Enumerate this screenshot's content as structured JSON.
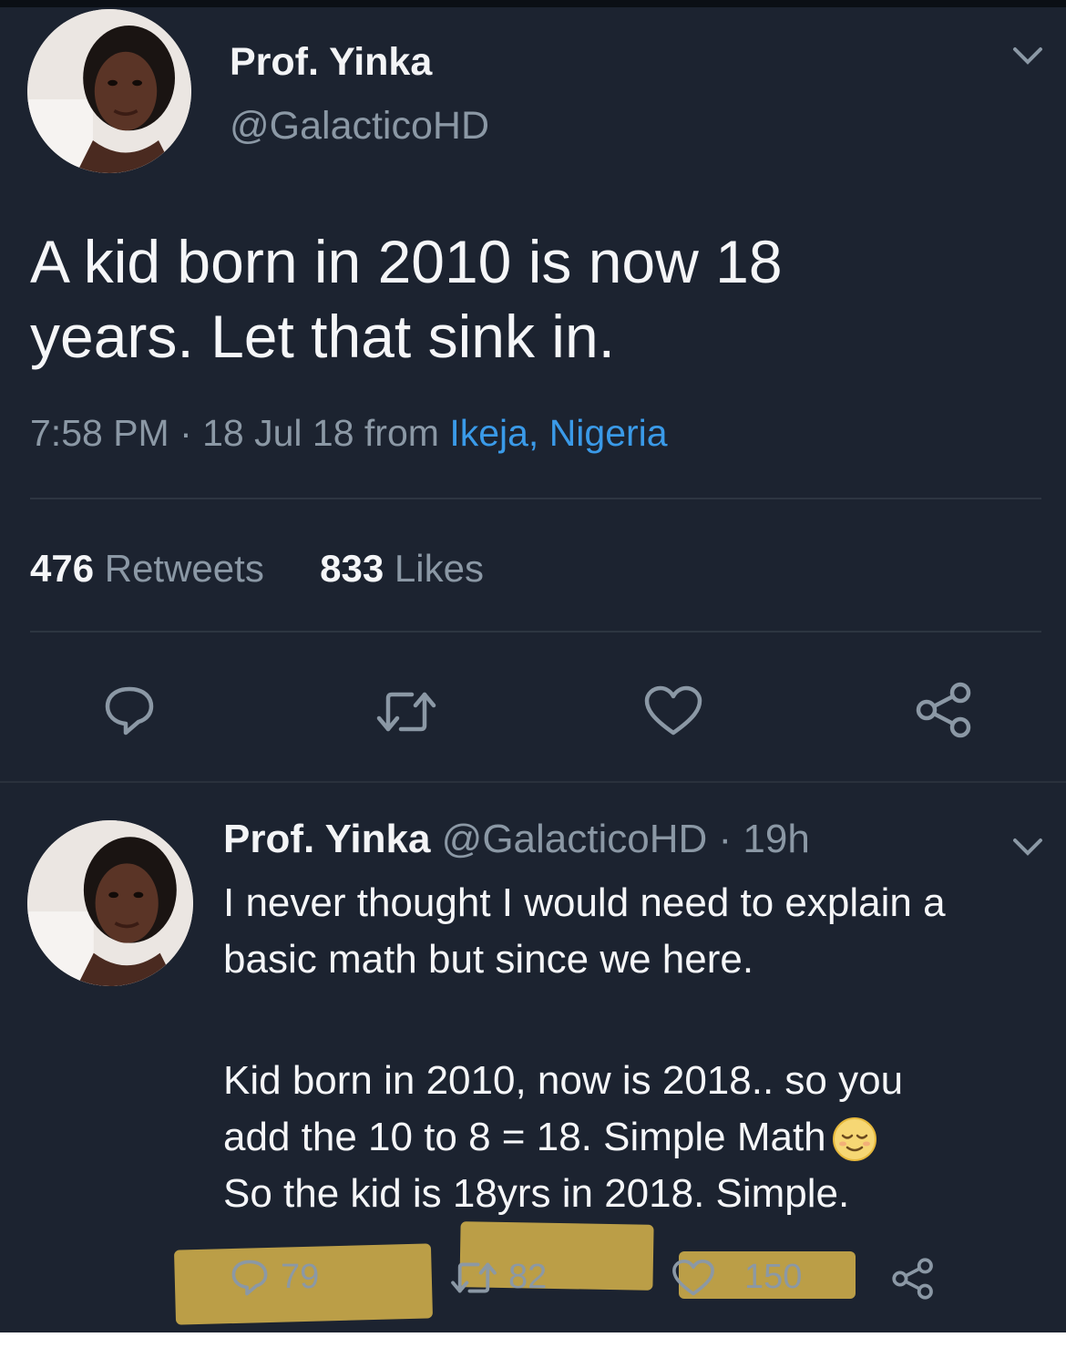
{
  "tweet": {
    "name": "Prof. Yinka",
    "handle": "@GalacticoHD",
    "text_line1": "A kid born in 2010 is now 18",
    "text_line2": "years. Let that sink in.",
    "time": "7:58 PM · 18 Jul 18 from ",
    "location": "Ikeja, Nigeria",
    "retweets_count": "476",
    "retweets_label": " Retweets",
    "likes_count": "833",
    "likes_label": " Likes",
    "actions": [
      "reply-icon",
      "retweet-icon",
      "heart-icon",
      "share-icon"
    ]
  },
  "reply": {
    "name": "Prof. Yinka",
    "handle_time": " @GalacticoHD · 19h",
    "line1": "I never thought I would need to explain a",
    "line2": "basic math but since we here.",
    "line3": "Kid born in 2010, now is 2018.. so you",
    "line4": "add the 10 to 8 = 18. Simple Math",
    "line5": "So the kid is 18yrs in 2018. Simple.",
    "reply_count": "79",
    "retweet_count": "82",
    "like_count": "150"
  },
  "colors": {
    "background": "#1c2330",
    "text": "#f5f6f8",
    "muted": "#8b98a5",
    "link": "#3a9ae8",
    "highlight": "#c9a94a"
  }
}
